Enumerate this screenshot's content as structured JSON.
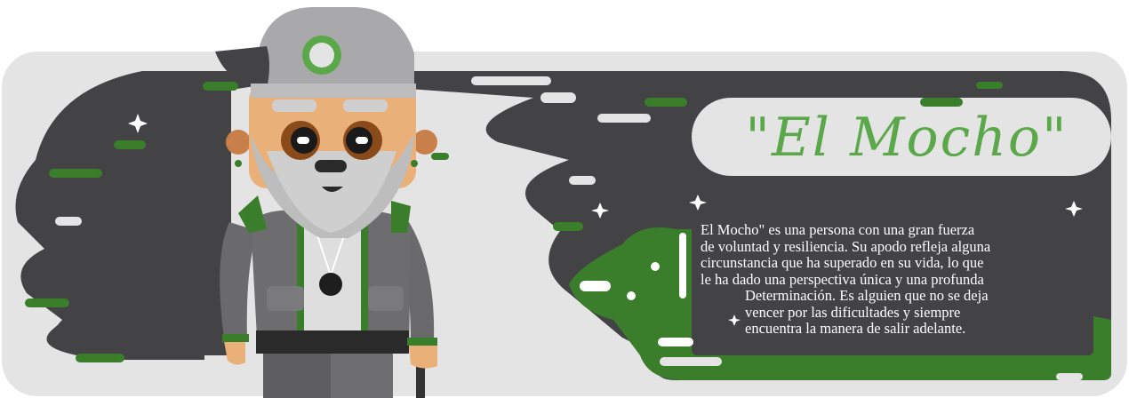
{
  "title": "\"El Mocho\"",
  "description_lines": [
    "El Mocho\" es una persona con una gran fuerza",
    "de voluntad y resiliencia. Su apodo refleja alguna",
    "circunstancia que ha superado en su vida, lo que",
    "le ha dado una perspectiva única y una profunda",
    "Determinación. Es alguien que no se deja",
    "vencer por las dificultades y siempre",
    "encuentra la manera de salir adelante."
  ],
  "colors": {
    "panel": "#e4e4e4",
    "dark": "#434345",
    "green": "#3a7d2a",
    "title_green": "#5aa84a",
    "white": "#ffffff"
  },
  "icons": [
    "sparkle-icon",
    "old-man-character-illustration"
  ]
}
